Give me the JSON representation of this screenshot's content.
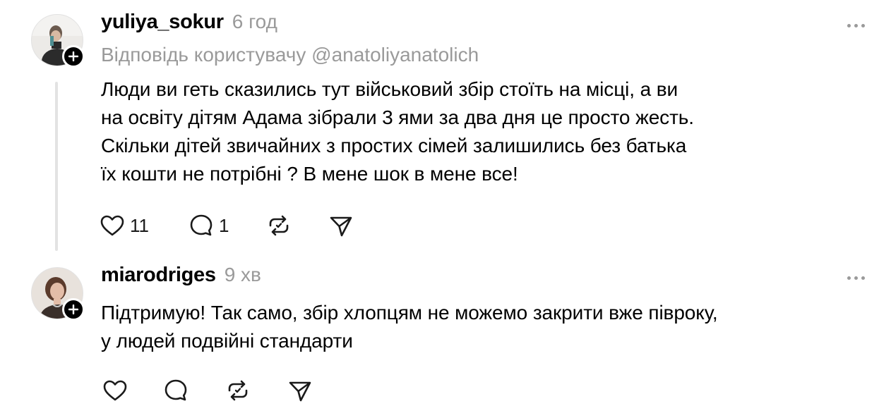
{
  "thread": [
    {
      "username": "yuliya_sokur",
      "time": "6 год",
      "reply_to": "Відповідь користувачу @anatoliyanatolich",
      "lines": [
        "Люди ви геть сказились тут військовий збір стоїть на місці, а ви",
        "на освіту дітям Адама зібрали 3 ями за два дня це просто жесть.",
        "Скільки дітей звичайних з простих сімей залишились без батька",
        "їх кошти не потрібні ? В мене шок в мене все!"
      ],
      "likes": "11",
      "replies": "1",
      "icons": [
        "heart-icon",
        "comment-icon",
        "repost-icon",
        "share-icon"
      ]
    },
    {
      "username": "miarodriges",
      "time": "9 хв",
      "lines": [
        "Підтримую! Так само, збір хлопцям не можемо закрити вже півроку,",
        "у людей подвійні стандарти"
      ],
      "icons": [
        "heart-icon",
        "comment-icon",
        "repost-icon",
        "share-icon"
      ]
    }
  ],
  "colors": {
    "muted": "#9a9a9a",
    "thread_line": "#e3e3e3",
    "text": "#000000"
  }
}
